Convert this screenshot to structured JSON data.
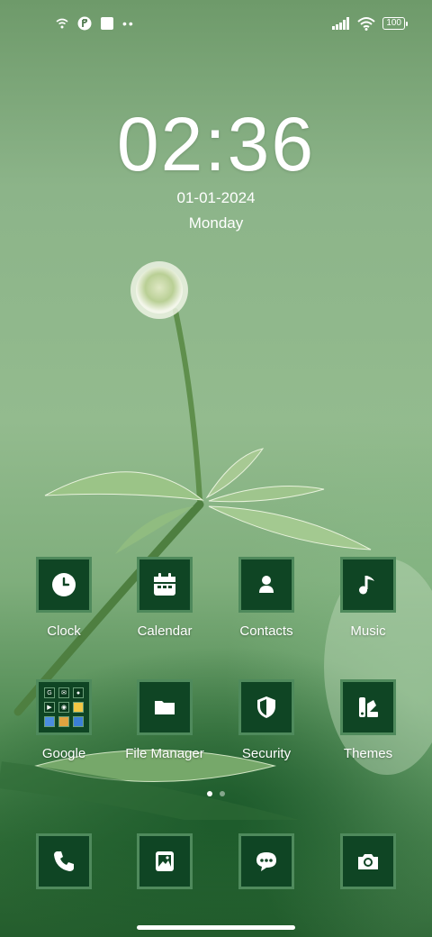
{
  "status_bar": {
    "left_icons": [
      "wifi-question-icon",
      "app-notification-icon",
      "square-icon",
      "more-dots-icon"
    ],
    "right_icons": [
      "signal-icon",
      "wifi-icon",
      "battery-icon"
    ],
    "battery": "100"
  },
  "lockscreen": {
    "time": "02:36",
    "date": "01-01-2024",
    "day": "Monday"
  },
  "apps_row1": [
    {
      "label": "Clock",
      "icon": "clock-icon"
    },
    {
      "label": "Calendar",
      "icon": "calendar-icon"
    },
    {
      "label": "Contacts",
      "icon": "contact-icon"
    },
    {
      "label": "Music",
      "icon": "music-note-icon"
    }
  ],
  "apps_row2": [
    {
      "label": "Google",
      "icon": "google-folder-icon"
    },
    {
      "label": "File Manager",
      "icon": "folder-icon"
    },
    {
      "label": "Security",
      "icon": "shield-icon"
    },
    {
      "label": "Themes",
      "icon": "brush-icon"
    }
  ],
  "dock": [
    {
      "icon": "phone-icon"
    },
    {
      "icon": "gallery-icon"
    },
    {
      "icon": "messages-icon"
    },
    {
      "icon": "camera-icon"
    }
  ],
  "pager": {
    "pages": 2,
    "current": 1
  },
  "colors": {
    "tile_bg": "#0f4524",
    "tile_border": "#4f8a5c"
  }
}
